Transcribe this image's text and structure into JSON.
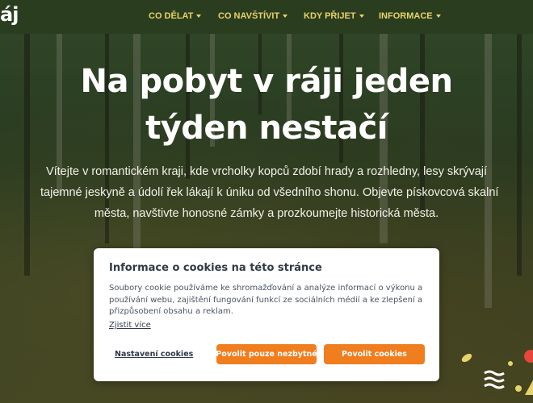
{
  "header": {
    "logo_text": "áj",
    "nav": [
      {
        "label": "CO DĚLAT"
      },
      {
        "label": "CO NAVŠTÍVIT"
      },
      {
        "label": "KDY PŘIJET"
      },
      {
        "label": "INFORMACE"
      }
    ]
  },
  "hero": {
    "title_lines": [
      "Na pobyt v ráji jeden",
      "týden nestačí"
    ],
    "text_lines": [
      "Vítejte v romantickém kraji, kde vrcholky kopců zdobí hrady a rozhledny, lesy skrývají",
      "tajemné jeskyně a údolí řek lákají k úniku od všedního shonu. Objevte pískovcová skalní",
      "města, navštivte honosné zámky a prozkoumejte historická města."
    ]
  },
  "cookie": {
    "title": "Informace o cookies na této stránce",
    "text_lines": [
      "Soubory cookie používáme ke shromažďování a analýze informací o výkonu a",
      "používání webu, zajištění fungování funkcí ze sociálních médií a ke zlepšení a",
      "přizpůsobení obsahu a reklam."
    ],
    "more_link": "Zjistit více",
    "settings_button": "Nastavení cookies",
    "necessary_button": "Povolit pouze nezbytné",
    "allow_button": "Povolit cookies"
  },
  "colors": {
    "header_bg": "#2b3d1f",
    "nav_text": "#e6d36a",
    "accent_button": "#f07d1e"
  }
}
